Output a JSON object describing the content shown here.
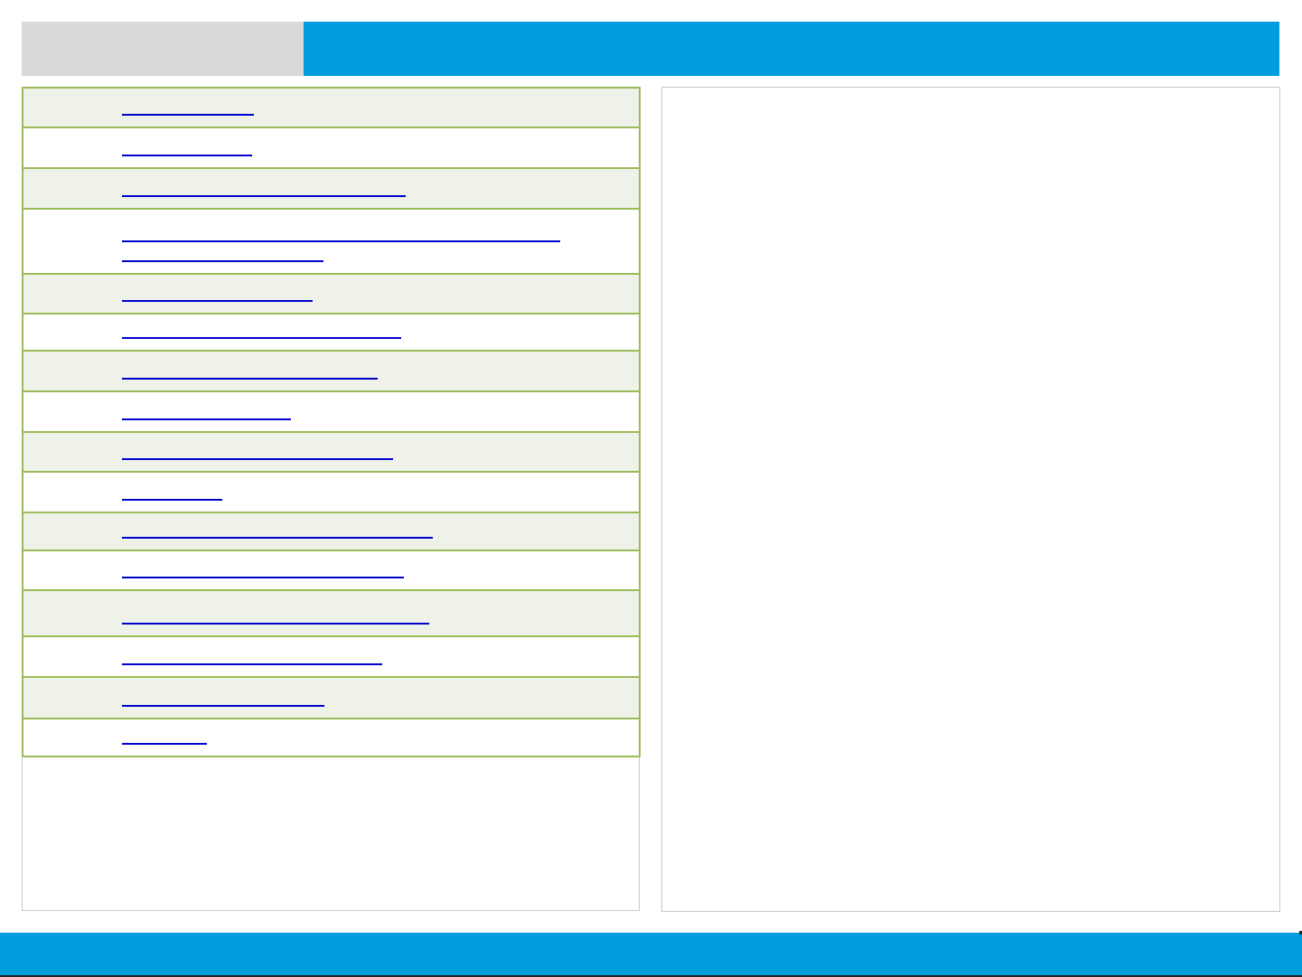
{
  "header": {
    "title": "",
    "subtitle": ""
  },
  "links": {
    "items": [
      {
        "label": ""
      },
      {
        "label": ""
      },
      {
        "label": ""
      },
      {
        "label": ""
      },
      {
        "label": ""
      },
      {
        "label": ""
      },
      {
        "label": ""
      },
      {
        "label": ""
      },
      {
        "label": ""
      },
      {
        "label": ""
      },
      {
        "label": ""
      },
      {
        "label": ""
      },
      {
        "label": ""
      },
      {
        "label": ""
      },
      {
        "label": ""
      },
      {
        "label": ""
      }
    ]
  },
  "theme": {
    "accent_blue": "#009ddd",
    "header_gray": "#d9d9d9",
    "row_border_green": "#9bbb59",
    "row_alt_fill": "#eff2e9",
    "link_color": "#0000cc"
  }
}
